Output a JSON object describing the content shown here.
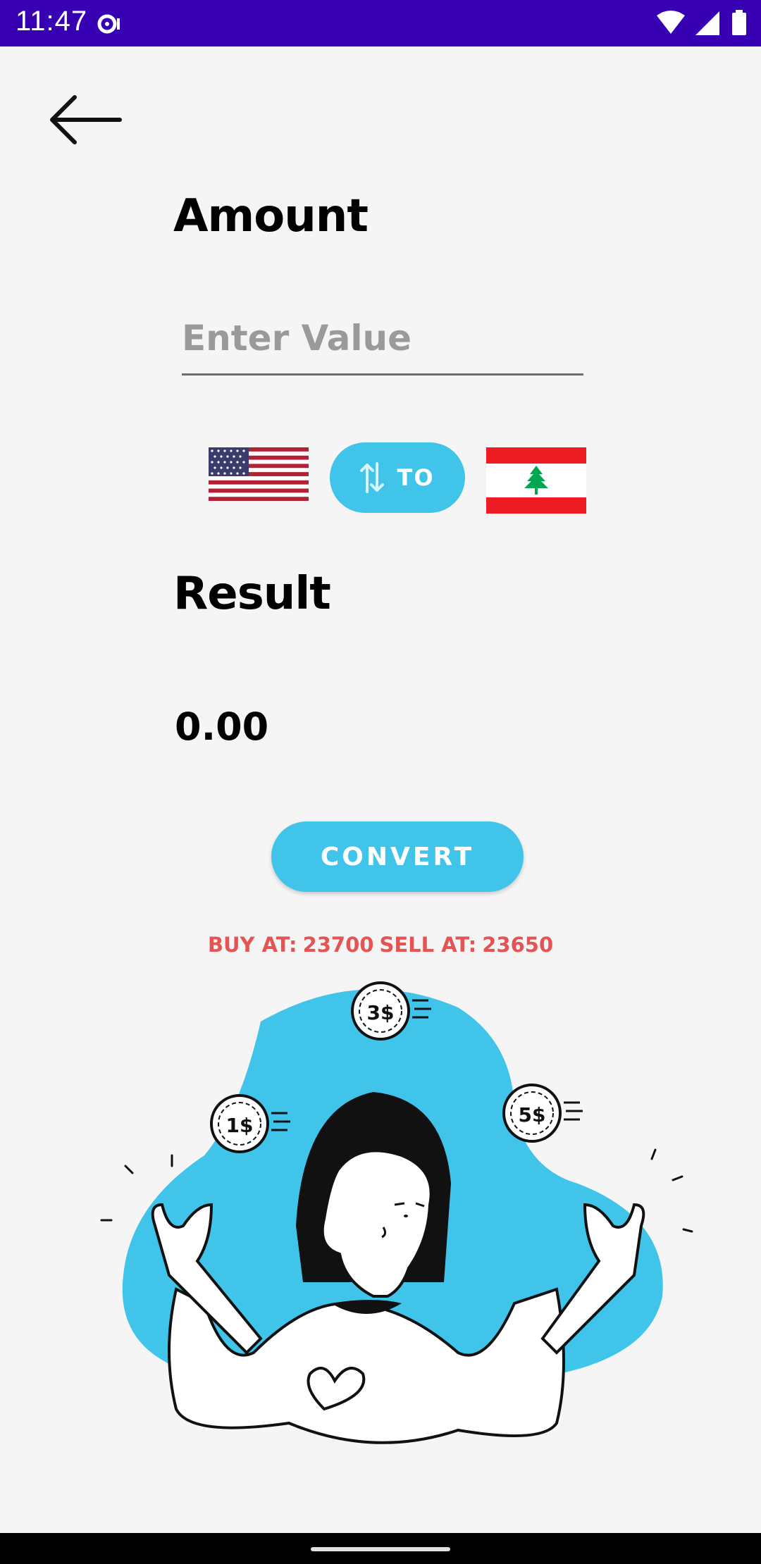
{
  "status_bar": {
    "time": "11:47"
  },
  "amount": {
    "title": "Amount",
    "placeholder": "Enter Value",
    "value": ""
  },
  "currency": {
    "from": "USD flag",
    "to": "Lebanon flag",
    "swap_label": "TO"
  },
  "result": {
    "title": "Result",
    "value": "0.00"
  },
  "convert": {
    "label": "CONVERT"
  },
  "rates": {
    "buy_label": "BUY AT:",
    "buy_value": "23700",
    "sell_label": "SELL AT:",
    "sell_value": "23650"
  },
  "illustration": {
    "coin_1": "1$",
    "coin_2": "3$",
    "coin_3": "5$"
  },
  "colors": {
    "accent": "#40c4ea",
    "status_bar": "#3700b3",
    "rates_text": "#e45454",
    "background": "#f5f5f5"
  }
}
